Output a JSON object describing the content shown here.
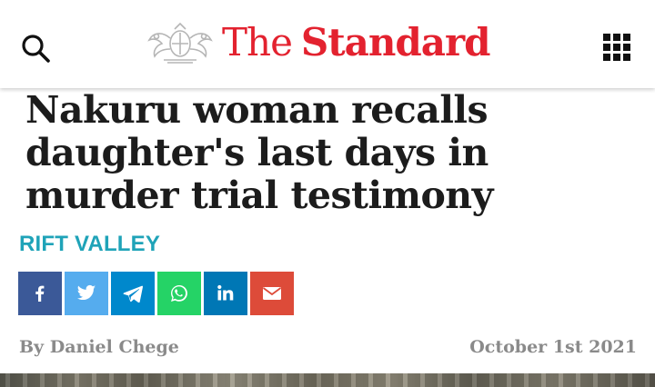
{
  "header": {
    "brand_the": "The",
    "brand_standard": "Standard",
    "brand_color": "#e3222f",
    "search_icon": "search-icon",
    "menu_icon": "grid-menu-icon"
  },
  "article": {
    "headline_lines": [
      "Nakuru woman recalls",
      "daughter's last days in",
      "murder trial testimony"
    ],
    "category": "RIFT VALLEY",
    "category_color": "#1fa3b8",
    "author": "By Daniel Chege",
    "date": "October 1st 2021"
  },
  "share": {
    "buttons": [
      {
        "name": "facebook",
        "icon": "facebook-icon",
        "color": "#3b5998"
      },
      {
        "name": "twitter",
        "icon": "twitter-icon",
        "color": "#55acee"
      },
      {
        "name": "telegram",
        "icon": "telegram-icon",
        "color": "#0088cc"
      },
      {
        "name": "whatsapp",
        "icon": "whatsapp-icon",
        "color": "#25d366"
      },
      {
        "name": "linkedin",
        "icon": "linkedin-icon",
        "color": "#0077b5"
      },
      {
        "name": "email",
        "icon": "email-icon",
        "color": "#dd4b39"
      }
    ]
  }
}
